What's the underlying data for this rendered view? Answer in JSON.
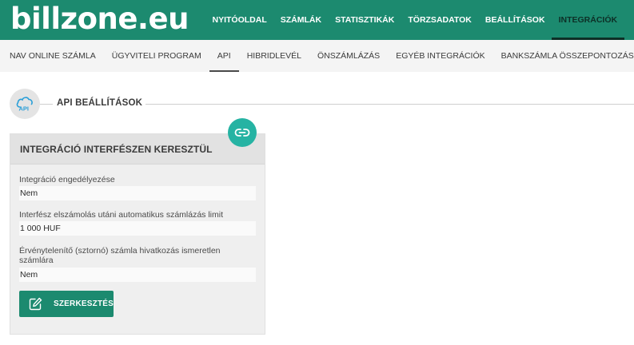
{
  "header": {
    "logo_text": "billzone.eu",
    "nav": [
      {
        "label": "NYITÓOLDAL"
      },
      {
        "label": "SZÁMLÁK"
      },
      {
        "label": "STATISZTIKÁK"
      },
      {
        "label": "TÖRZSADATOK"
      },
      {
        "label": "BEÁLLÍTÁSOK"
      },
      {
        "label": "INTEGRÁCIÓK",
        "active": true
      }
    ],
    "brand_color": "#1c8a6f"
  },
  "subnav": [
    {
      "label": "NAV ONLINE SZÁMLA"
    },
    {
      "label": "ÜGYVITELI PROGRAM"
    },
    {
      "label": "API",
      "active": true
    },
    {
      "label": "HIBRIDLEVÉL"
    },
    {
      "label": "ÖNSZÁMLÁZÁS"
    },
    {
      "label": "EGYÉB INTEGRÁCIÓK"
    },
    {
      "label": "BANKSZÁMLA ÖSSZEPONTOZÁS"
    }
  ],
  "section": {
    "title": "API BEÁLLÍTÁSOK",
    "icon": "api-cloud-icon",
    "icon_text": "API"
  },
  "card": {
    "title": "INTEGRÁCIÓ INTERFÉSZEN KERESZTÜL",
    "badge_icon": "link-icon",
    "fields": [
      {
        "label": "Integráció engedélyezése",
        "value": "Nem"
      },
      {
        "label": "Interfész elszámolás utáni automatikus számlázás limit",
        "value": "1 000 HUF"
      },
      {
        "label": "Érvénytelenítő (sztornó) számla hivatkozás ismeretlen számlára",
        "value": "Nem"
      }
    ],
    "edit_button": {
      "label": "SZERKESZTÉS",
      "icon": "edit-icon"
    },
    "accent_color": "#26b3a3"
  }
}
